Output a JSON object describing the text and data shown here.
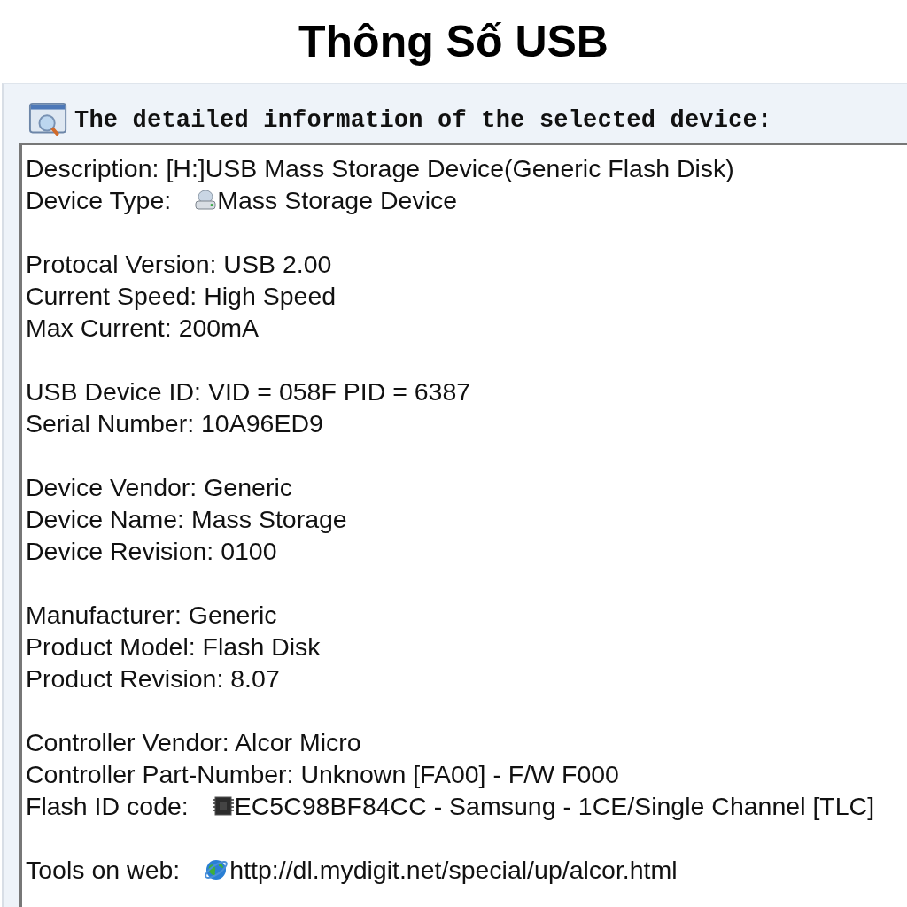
{
  "title": "Thông Số USB",
  "panel": {
    "heading": "The detailed information of the selected device:"
  },
  "groups": [
    [
      {
        "kind": "plain",
        "text": "Description: [H:]USB Mass Storage Device(Generic Flash Disk)"
      },
      {
        "kind": "drive",
        "label": "Device Type:",
        "value": "Mass Storage Device"
      }
    ],
    [
      {
        "kind": "plain",
        "text": "Protocal Version: USB 2.00"
      },
      {
        "kind": "plain",
        "text": "Current Speed: High Speed"
      },
      {
        "kind": "plain",
        "text": "Max Current: 200mA"
      }
    ],
    [
      {
        "kind": "plain",
        "text": "USB Device ID: VID = 058F PID = 6387"
      },
      {
        "kind": "plain",
        "text": "Serial Number: 10A96ED9"
      }
    ],
    [
      {
        "kind": "plain",
        "text": "Device Vendor: Generic"
      },
      {
        "kind": "plain",
        "text": "Device Name: Mass Storage"
      },
      {
        "kind": "plain",
        "text": "Device Revision: 0100"
      }
    ],
    [
      {
        "kind": "plain",
        "text": "Manufacturer: Generic"
      },
      {
        "kind": "plain",
        "text": "Product Model: Flash Disk"
      },
      {
        "kind": "plain",
        "text": "Product Revision: 8.07"
      }
    ],
    [
      {
        "kind": "plain",
        "text": "Controller Vendor: Alcor Micro"
      },
      {
        "kind": "plain",
        "text": "Controller Part-Number: Unknown [FA00] - F/W F000"
      },
      {
        "kind": "chip",
        "label": "Flash ID code:",
        "value": "EC5C98BF84CC - Samsung - 1CE/Single Channel [TLC]"
      }
    ],
    [
      {
        "kind": "link",
        "label": "Tools on web:",
        "value": "http://dl.mydigit.net/special/up/alcor.html"
      }
    ]
  ]
}
